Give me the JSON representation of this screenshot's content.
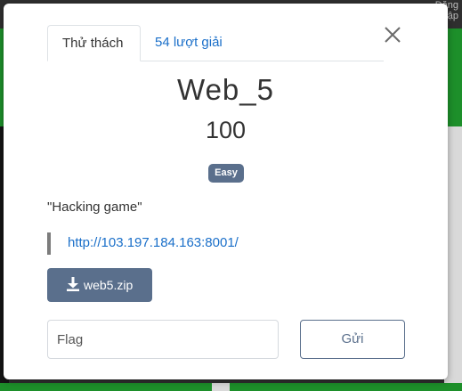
{
  "background": {
    "top_right_text": "Đăng nhập",
    "colors": {
      "green": "#1d8f2a",
      "dark": "#2f2f2f"
    }
  },
  "modal": {
    "tabs": [
      {
        "label": "Thử thách",
        "active": true
      },
      {
        "label": "54 lượt giải",
        "active": false
      }
    ],
    "close_icon": "close-icon",
    "challenge": {
      "name": "Web_5",
      "points": "100",
      "difficulty": "Easy",
      "description": "\"Hacking game\"",
      "link": "http://103.197.184.163:8001/",
      "file": "web5.zip"
    },
    "flag_input": {
      "placeholder": "Flag",
      "value": ""
    },
    "submit_label": "Gửi",
    "colors": {
      "accent": "#5a6f8c",
      "link": "#1a6fc9"
    }
  }
}
